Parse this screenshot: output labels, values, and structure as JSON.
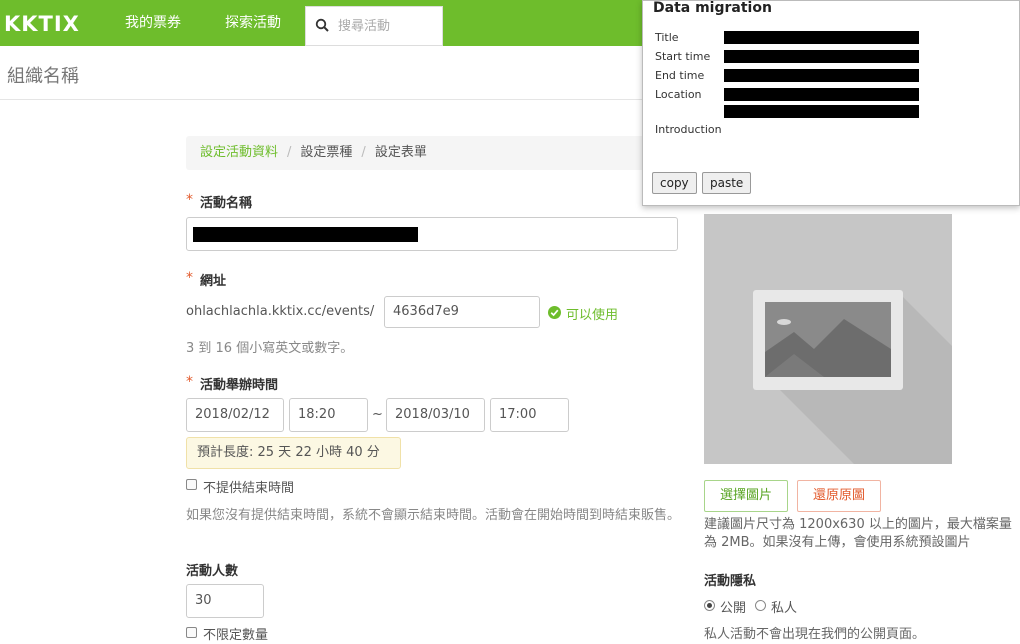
{
  "nav": {
    "logo": "KKTIX",
    "my_tickets": "我的票券",
    "explore": "探索活動",
    "search_placeholder": "搜尋活動"
  },
  "org": {
    "name": "組織名稱"
  },
  "breadcrumb": [
    "設定活動資料",
    "設定票種",
    "設定表單"
  ],
  "form": {
    "event_name_label": "活動名稱",
    "url_label": "網址",
    "url_prefix": "ohlachlachla.kktix.cc/events/",
    "url_slug": "4636d7e9",
    "url_available": "可以使用",
    "url_help": "3 到 16 個小寫英文或數字。",
    "time_label": "活動舉辦時間",
    "start_date": "2018/02/12",
    "start_time": "18:20",
    "range_sep": "~",
    "end_date": "2018/03/10",
    "end_time": "17:00",
    "duration": "預計長度: 25 天 22 小時 40 分",
    "no_end_time": "不提供結束時間",
    "no_end_help": "如果您沒有提供結束時間，系統不會顯示結束時間。活動會在開始時間到時結束販售。",
    "attendees_label": "活動人數",
    "attendees_value": "30",
    "unlimited": "不限定數量"
  },
  "image": {
    "choose": "選擇圖片",
    "restore": "還原原圖",
    "help": "建議圖片尺寸為 1200x630 以上的圖片，最大檔案量為 2MB。如果沒有上傳，會使用系統預設圖片"
  },
  "privacy": {
    "label": "活動隱私",
    "public": "公開",
    "private": "私人",
    "help": "私人活動不會出現在我們的公開頁面。"
  },
  "popup": {
    "title": "Data migration",
    "title_field": "Title",
    "start_time": "Start time",
    "end_time": "End time",
    "location": "Location",
    "introduction": "Introduction",
    "copy": "copy",
    "paste": "paste"
  },
  "colors": {
    "brand": "#6ebd2c",
    "required": "#e25a2c",
    "restore": "#e25a2c"
  }
}
